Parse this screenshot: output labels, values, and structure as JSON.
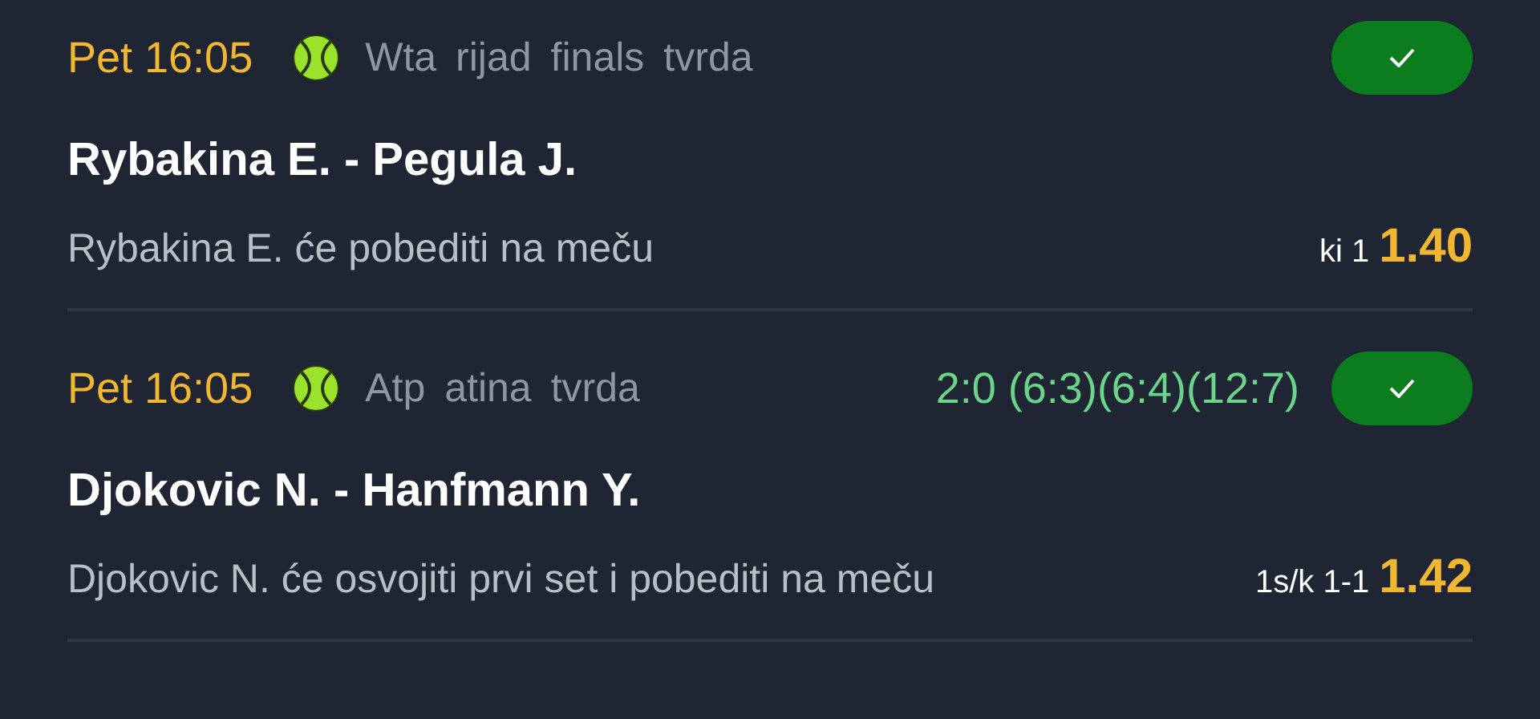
{
  "bets": [
    {
      "time": "Pet 16:05",
      "league": [
        "Wta",
        "rijad",
        "finals",
        "tvrda"
      ],
      "match": "Rybakina E. - Pegula J.",
      "pick": "Rybakina E. će pobediti na meču",
      "market": "ki 1",
      "odds": "1.40",
      "won": true
    },
    {
      "time": "Pet 16:05",
      "league": [
        "Atp",
        "atina",
        "tvrda"
      ],
      "score": "2:0 (6:3)(6:4)(12:7)",
      "match": "Djokovic N. - Hanfmann Y.",
      "pick": "Djokovic N. će osvojiti prvi set i pobediti na meču",
      "market": "1s/k 1-1",
      "odds": "1.42",
      "won": true
    }
  ]
}
